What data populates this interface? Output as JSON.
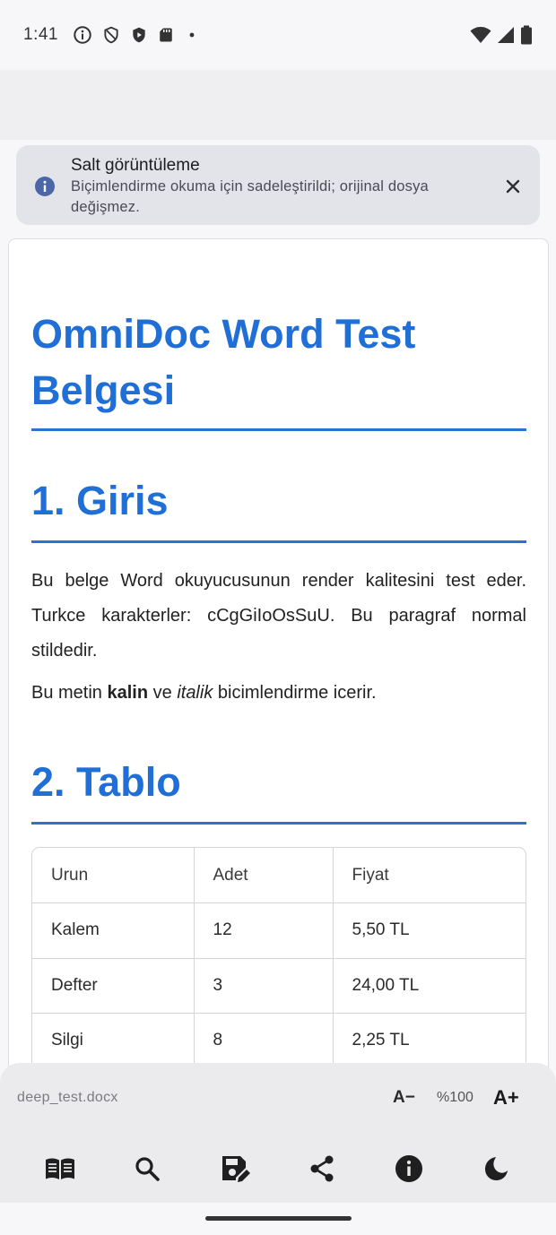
{
  "status_bar": {
    "time": "1:41",
    "icons": [
      "info-circle-icon",
      "shield-icon",
      "shield-play-icon",
      "sd-card-icon",
      "dot-icon",
      "wifi-icon",
      "signal-icon",
      "battery-icon"
    ]
  },
  "banner": {
    "title": "Salt görüntüleme",
    "body": "Biçimlendirme okuma için sadeleştirildi; orijinal dosya değişmez.",
    "icon": "info-icon",
    "close_icon": "close-icon"
  },
  "document": {
    "title": "OmniDoc Word Test Belgesi",
    "section1": {
      "heading": "1. Giris",
      "para1": "Bu belge Word okuyucusunun render kalitesini test eder. Turkce karakterler: cCgGiIoOsSuU. Bu paragraf normal stildedir.",
      "para2_prefix": "Bu metin ",
      "para2_bold": "kalin",
      "para2_mid": " ve ",
      "para2_italic": "italik",
      "para2_suffix": " bicimlendirme icerir."
    },
    "section2": {
      "heading": "2. Tablo",
      "table": {
        "headers": [
          "Urun",
          "Adet",
          "Fiyat"
        ],
        "rows": [
          [
            "Kalem",
            "12",
            "5,50 TL"
          ],
          [
            "Defter",
            "3",
            "24,00 TL"
          ],
          [
            "Silgi",
            "8",
            "2,25 TL"
          ]
        ]
      }
    }
  },
  "bottom_bar": {
    "file_name": "deep_test.docx",
    "zoom_decrease_label": "A−",
    "zoom_level": "%100",
    "zoom_increase_label": "A+",
    "toolbar": [
      "reader-mode-icon",
      "search-icon",
      "save-edit-icon",
      "share-icon",
      "info-icon",
      "dark-mode-icon"
    ]
  },
  "colors": {
    "accent": "#1f6fd6",
    "banner_bg": "#e3e4ea",
    "panel_bg": "#ebebee"
  }
}
